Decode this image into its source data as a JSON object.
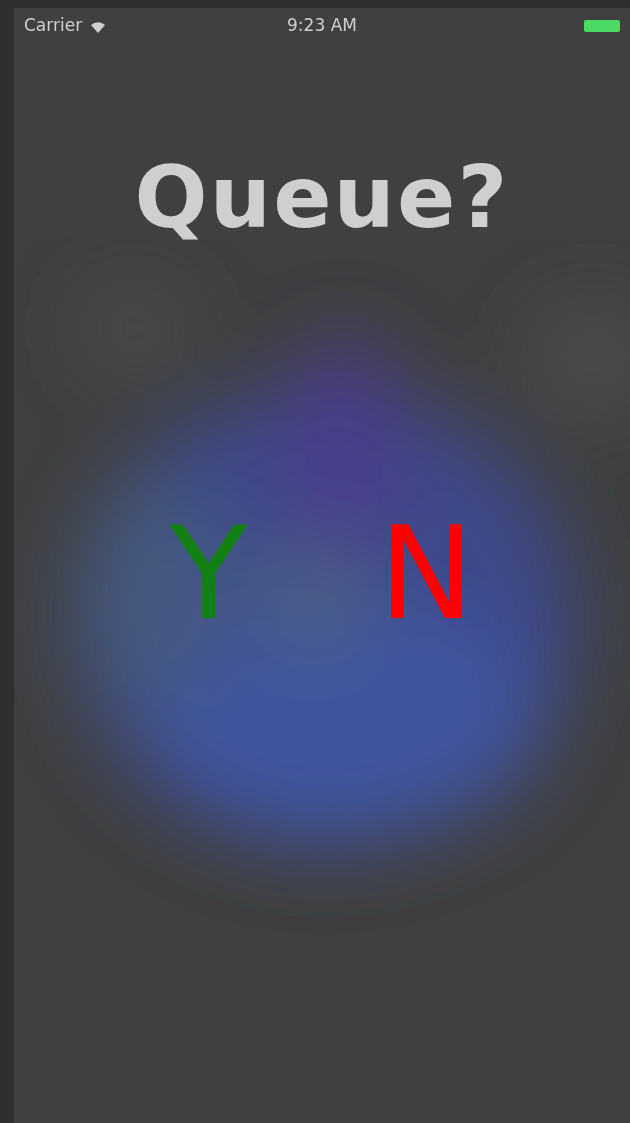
{
  "status_bar": {
    "carrier": "Carrier",
    "time": "9:23 AM"
  },
  "title": "Queue?",
  "answers": [
    {
      "label": "Y",
      "color": "#138013"
    },
    {
      "label": "N",
      "color": "#ff0000"
    }
  ]
}
